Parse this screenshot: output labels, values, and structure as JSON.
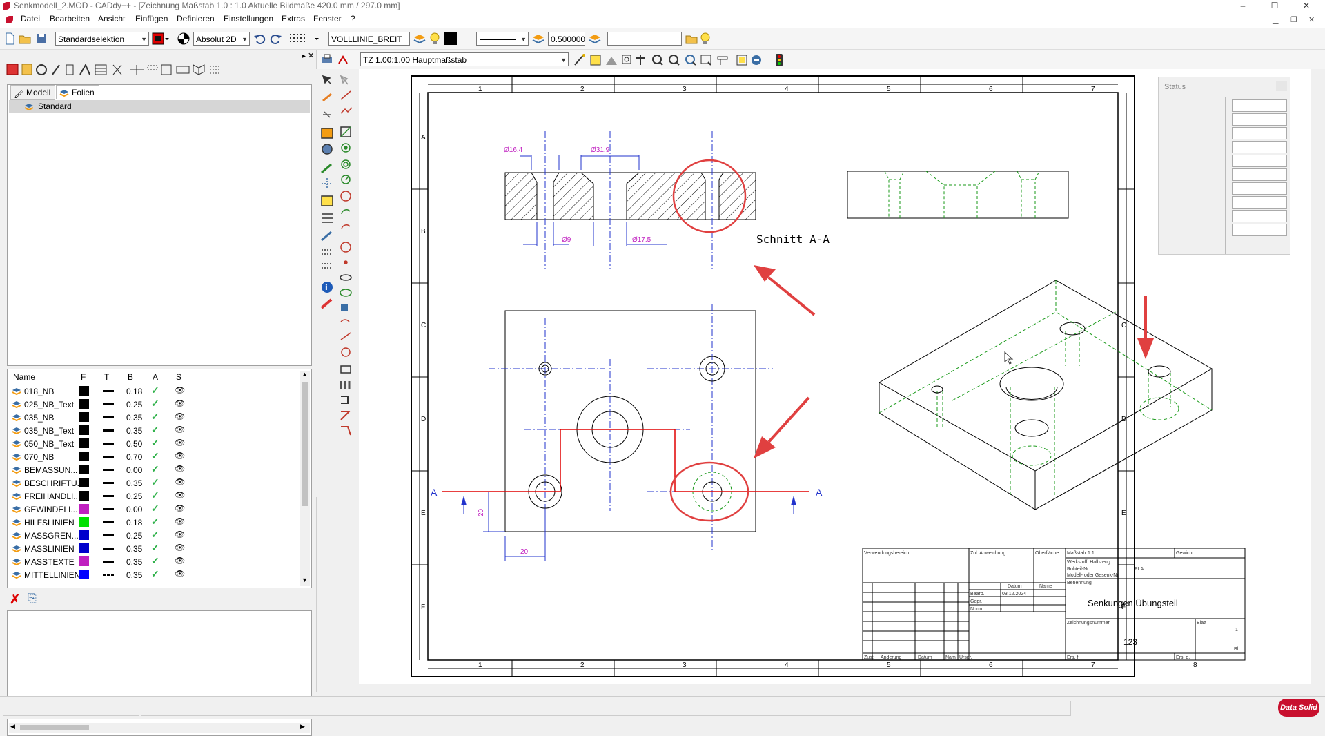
{
  "window": {
    "title": "Senkmodell_2.MOD  -  CADdy++ - [Zeichnung   Maßstab 1.0 : 1.0   Aktuelle Bildmaße 420.0 mm / 297.0 mm]",
    "minimize": "–",
    "maximize": "☐",
    "close": "✕"
  },
  "menu": {
    "items": [
      "Datei",
      "Bearbeiten",
      "Ansicht",
      "Einfügen",
      "Definieren",
      "Einstellungen",
      "Extras",
      "Fenster",
      "?"
    ]
  },
  "toolbar": {
    "selection_mode": "Standardselektion",
    "coord_mode": "Absolut 2D",
    "line_type": "VOLLLINIE_BREIT",
    "line_width": "0.500000",
    "scale": "TZ 1.00:1.00 Hauptmaßstab"
  },
  "left_panel": {
    "tabs": [
      "Modell",
      "Folien"
    ],
    "tree_root": "Standard",
    "layer_headers": [
      "Name",
      "F",
      "T",
      "B",
      "A",
      "S"
    ],
    "layers": [
      {
        "name": "018_NB",
        "color": "#000000",
        "width": "0.18",
        "dashed": false
      },
      {
        "name": "025_NB_Text",
        "color": "#000000",
        "width": "0.25",
        "dashed": false
      },
      {
        "name": "035_NB",
        "color": "#000000",
        "width": "0.35",
        "dashed": false
      },
      {
        "name": "035_NB_Text",
        "color": "#000000",
        "width": "0.35",
        "dashed": false
      },
      {
        "name": "050_NB_Text",
        "color": "#000000",
        "width": "0.50",
        "dashed": false
      },
      {
        "name": "070_NB",
        "color": "#000000",
        "width": "0.70",
        "dashed": false
      },
      {
        "name": "BEMASSUN...",
        "color": "#000000",
        "width": "0.00",
        "dashed": false
      },
      {
        "name": "BESCHRIFTU...",
        "color": "#000000",
        "width": "0.35",
        "dashed": false
      },
      {
        "name": "FREIHANDLI...",
        "color": "#000000",
        "width": "0.25",
        "dashed": false
      },
      {
        "name": "GEWINDELI...",
        "color": "#c020c0",
        "width": "0.00",
        "dashed": false
      },
      {
        "name": "HILFSLINIEN",
        "color": "#00e000",
        "width": "0.18",
        "dashed": false
      },
      {
        "name": "MASSGREN...",
        "color": "#0000cc",
        "width": "0.25",
        "dashed": false
      },
      {
        "name": "MASSLINIEN",
        "color": "#0000cc",
        "width": "0.35",
        "dashed": false
      },
      {
        "name": "MASSTEXTE",
        "color": "#c020c0",
        "width": "0.35",
        "dashed": false
      },
      {
        "name": "MITTELLINIEN",
        "color": "#0000ff",
        "width": "0.35",
        "dashed": true
      }
    ]
  },
  "drawing": {
    "columns": [
      "1",
      "2",
      "3",
      "4",
      "5",
      "6",
      "7",
      "8"
    ],
    "rows": [
      "A",
      "B",
      "C",
      "D",
      "E",
      "F"
    ],
    "dims": {
      "d1": "Ø16.4",
      "d2": "Ø31.9",
      "d3": "Ø9",
      "d4": "Ø17.5",
      "d5": "20",
      "d6": "20"
    },
    "section_label": "Schnitt A-A",
    "section_mark": "A",
    "titleblock": {
      "verwendung": "Verwendungsbereich",
      "zul": "Zul. Abweichung",
      "oberflaeche": "Oberfläche",
      "massstab_label": "Maßstab",
      "massstab": "1:1",
      "gewicht": "Gewicht",
      "werkstoff": "Werkstoff, Halbzeug",
      "rohteil": "Rohteil-Nr.",
      "material": "PLA",
      "modell": "Modell- oder Gesenk-Nr.",
      "datum": "Datum",
      "name": "Name",
      "benennung": "Benennung",
      "bearb": "Bearb.",
      "bearb_date": "03.12.2024",
      "gepr": "Gepr.",
      "norm": "Norm",
      "title": "Senkungen Übungsteil",
      "zeichnungsnummer": "Zeichnungsnummer",
      "number": "123",
      "blatt": "Blatt",
      "blatt_num": "1",
      "bl": "Bl.",
      "zust": "Zust.",
      "aenderung": "Änderung",
      "datum2": "Datum",
      "nam": "Nam",
      "urspr": "Urspr.",
      "ers_f": "Ers. f.",
      "ers_d": "Ers. d."
    }
  },
  "status_window": {
    "title": "Status"
  },
  "logo": "Data Solid"
}
